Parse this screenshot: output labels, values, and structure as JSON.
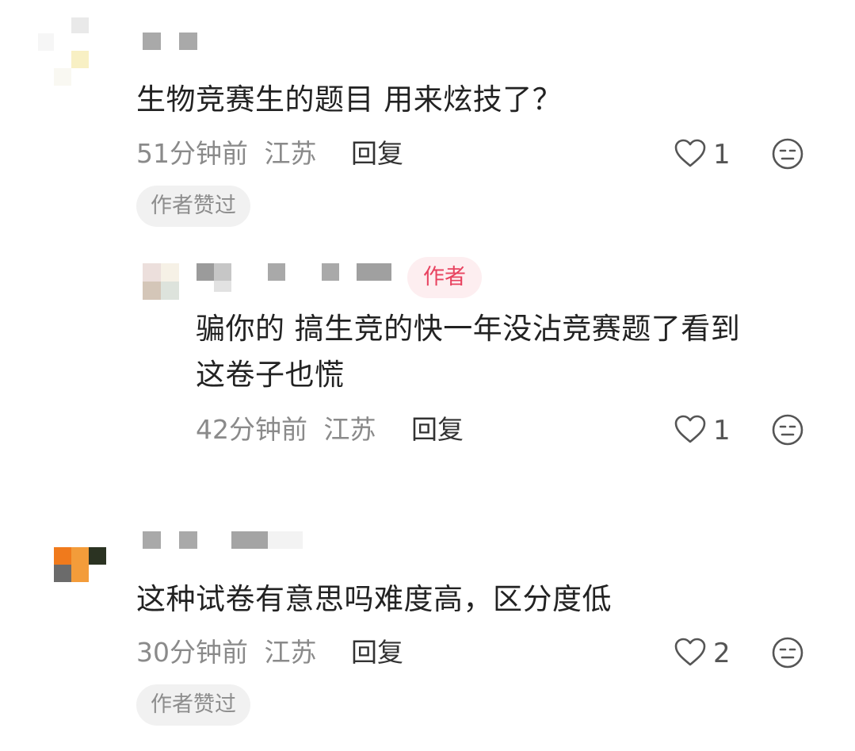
{
  "comments": [
    {
      "content": "生物竞赛生的题目 用来炫技了？",
      "time": "51分钟前",
      "location": "江苏",
      "reply_label": "回复",
      "like_count": "1",
      "badge": "作者赞过"
    },
    {
      "author_tag": "作者",
      "content_line1": "骗你的 搞生竞的快一年没沾竞赛题了看到",
      "content_line2": "这卷子也慌",
      "time": "42分钟前",
      "location": "江苏",
      "reply_label": "回复",
      "like_count": "1"
    },
    {
      "content": "这种试卷有意思吗难度高，区分度低",
      "time": "30分钟前",
      "location": "江苏",
      "reply_label": "回复",
      "like_count": "2",
      "badge": "作者赞过"
    }
  ],
  "icons": {
    "like": "heart-outline-icon",
    "reaction": "neutral-face-icon"
  },
  "colors": {
    "author_tag_text": "#e84360",
    "author_tag_bg": "#fdeef0",
    "meta_text": "#8a8a8a"
  }
}
